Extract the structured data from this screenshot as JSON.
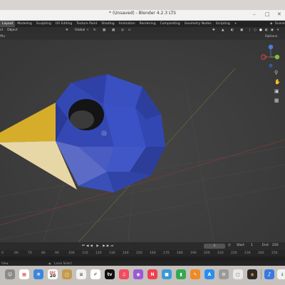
{
  "window": {
    "title": "* (Unsaved) - Blender 4.2.3 LTS"
  },
  "workspaces": {
    "tabs": [
      "Layout",
      "Modeling",
      "Sculpting",
      "UV Editing",
      "Texture Paint",
      "Shading",
      "Animation",
      "Rendering",
      "Compositing",
      "Geometry Nodes",
      "Scripting"
    ],
    "add": "+",
    "scene_label": "Scene"
  },
  "header": {
    "menu_object": "Object",
    "transform_orientation": "Global",
    "options": "Options"
  },
  "subheader": {
    "left": "ffix"
  },
  "timeline": {
    "current_frame": "1",
    "start_label": "Start",
    "start_value": "1",
    "end_label": "End",
    "end_value": "250"
  },
  "ruler": {
    "ticks": [
      "60",
      "70",
      "80",
      "90",
      "100",
      "110",
      "120",
      "130",
      "140",
      "150",
      "160",
      "170",
      "180",
      "190",
      "200",
      "210",
      "220",
      "230",
      "240",
      "250"
    ]
  },
  "statusbar": {
    "left": "View",
    "mid": "Lasso Select"
  },
  "dock": {
    "calendar_day": "20",
    "calendar_month": "DEC"
  },
  "colors": {
    "sphere_blue": "#3448b4",
    "light_yellow": "#d9b232",
    "viewport_bg": "#3d3d3d",
    "gizmo_x": "#d94c4c",
    "gizmo_y": "#7fbf3f",
    "gizmo_z": "#4a7fd9"
  }
}
